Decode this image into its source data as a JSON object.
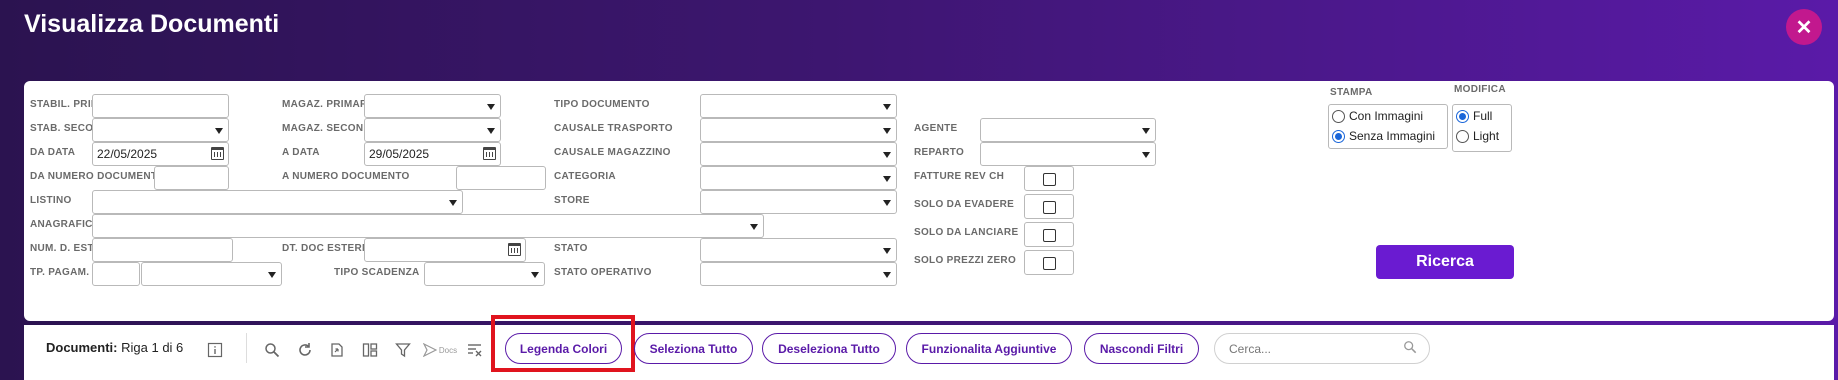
{
  "header": {
    "title": "Visualizza Documenti",
    "close_icon": "close-icon"
  },
  "filters": {
    "stabil_princ": {
      "label": "STABIL. PRINC.",
      "value": ""
    },
    "stab_secon": {
      "label": "STAB. SECON.",
      "value": ""
    },
    "da_data": {
      "label": "DA DATA",
      "value": "22/05/2025"
    },
    "da_numero": {
      "label": "DA NUMERO DOCUMENTO",
      "value": ""
    },
    "listino": {
      "label": "LISTINO",
      "value": ""
    },
    "anagrafica": {
      "label": "ANAGRAFICA",
      "value": ""
    },
    "num_d_est": {
      "label": "NUM. D. EST.",
      "value": ""
    },
    "tp_pagam": {
      "label": "TP. PAGAM.",
      "value": ""
    },
    "magaz_primario": {
      "label": "MAGAZ. PRIMARIO",
      "value": ""
    },
    "magaz_second": {
      "label": "MAGAZ. SECOND.",
      "value": ""
    },
    "a_data": {
      "label": "A DATA",
      "value": "29/05/2025"
    },
    "a_numero": {
      "label": "A NUMERO DOCUMENTO",
      "value": ""
    },
    "dt_doc_esterno": {
      "label": "DT. DOC ESTERNO",
      "value": ""
    },
    "tipo_scadenza": {
      "label": "TIPO SCADENZA",
      "value": ""
    },
    "tipo_documento": {
      "label": "TIPO DOCUMENTO",
      "value": ""
    },
    "causale_trasporto": {
      "label": "CAUSALE TRASPORTO",
      "value": ""
    },
    "causale_magazzino": {
      "label": "CAUSALE MAGAZZINO",
      "value": ""
    },
    "categoria": {
      "label": "CATEGORIA",
      "value": ""
    },
    "store": {
      "label": "STORE",
      "value": ""
    },
    "stato": {
      "label": "STATO",
      "value": ""
    },
    "stato_operativo": {
      "label": "STATO OPERATIVO",
      "value": ""
    },
    "agente": {
      "label": "AGENTE",
      "value": ""
    },
    "reparto": {
      "label": "REPARTO",
      "value": ""
    },
    "fatture_rev_ch": {
      "label": "FATTURE REV CH",
      "checked": false
    },
    "solo_da_evadere": {
      "label": "SOLO DA EVADERE",
      "checked": false
    },
    "solo_da_lanciare": {
      "label": "SOLO DA LANCIARE",
      "checked": false
    },
    "solo_prezzi_zero": {
      "label": "SOLO PREZZI ZERO",
      "checked": false
    }
  },
  "stampa": {
    "label": "STAMPA",
    "options": [
      "Con Immagini",
      "Senza Immagini"
    ],
    "selected": "Senza Immagini"
  },
  "modifica": {
    "label": "MODIFICA",
    "options": [
      "Full",
      "Light"
    ],
    "selected": "Full"
  },
  "ricerca_label": "Ricerca",
  "toolbar": {
    "title": "Documenti:",
    "subtitle": "Riga 1 di 6",
    "docs_label": "Docs",
    "buttons": {
      "legenda": "Legenda Colori",
      "seleziona": "Seleziona Tutto",
      "deseleziona": "Deseleziona Tutto",
      "funzionalita": "Funzionalita Aggiuntive",
      "nascondi": "Nascondi Filtri"
    },
    "search_placeholder": "Cerca..."
  },
  "colors": {
    "accent": "#6a1bd1",
    "highlight": "#e0141e",
    "close": "#c2188e"
  }
}
